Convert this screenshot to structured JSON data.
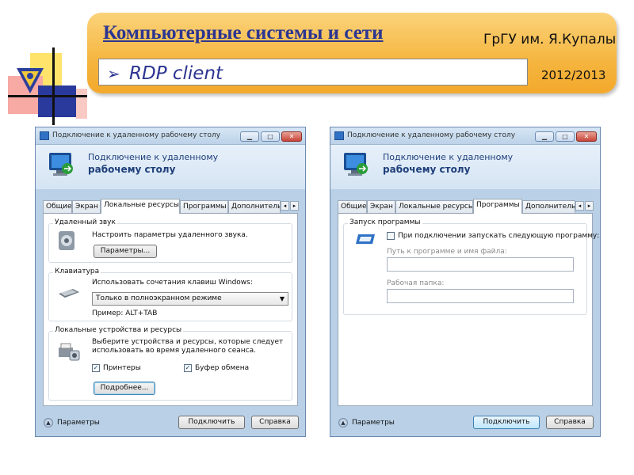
{
  "header": {
    "title": "Компьютерные системы и сети",
    "university": "ГрГУ им. Я.Купалы",
    "subtitle": "RDP client",
    "year": "2012/2013"
  },
  "windows": [
    {
      "title": "Подключение к удаленному рабочему столу",
      "heading_line1": "Подключение к удаленному",
      "heading_line2": "рабочему столу",
      "tabs": [
        "Общие",
        "Экран",
        "Локальные ресурсы",
        "Программы",
        "Дополнитель"
      ],
      "active_tab": "Локальные ресурсы",
      "groups": {
        "sound": {
          "label": "Удаленный звук",
          "description": "Настроить параметры удаленного звука.",
          "button": "Параметры..."
        },
        "keyboard": {
          "label": "Клавиатура",
          "description": "Использовать сочетания клавиш Windows:",
          "selected": "Только в полноэкранном режиме",
          "example": "Пример: ALT+TAB"
        },
        "devices": {
          "label": "Локальные устройства и ресурсы",
          "description_line1": "Выберите устройства и ресурсы, которые следует",
          "description_line2": "использовать во время удаленного сеанса.",
          "printers": "Принтеры",
          "printers_checked": true,
          "clipboard": "Буфер обмена",
          "clipboard_checked": true,
          "button": "Подробнее..."
        }
      },
      "footer": {
        "options": "Параметры",
        "connect": "Подключить",
        "help": "Справка"
      }
    },
    {
      "title": "Подключение к удаленному рабочему столу",
      "heading_line1": "Подключение к удаленному",
      "heading_line2": "рабочему столу",
      "tabs": [
        "Общие",
        "Экран",
        "Локальные ресурсы",
        "Программы",
        "Дополнитель"
      ],
      "active_tab": "Программы",
      "groups": {
        "startup": {
          "label": "Запуск программы",
          "checkbox": "При подключении запускать следующую программу:",
          "checked": false,
          "path_label": "Путь к программе и имя файла:",
          "path_value": "",
          "folder_label": "Рабочая папка:",
          "folder_value": ""
        }
      },
      "footer": {
        "options": "Параметры",
        "connect": "Подключить",
        "help": "Справка"
      }
    }
  ]
}
